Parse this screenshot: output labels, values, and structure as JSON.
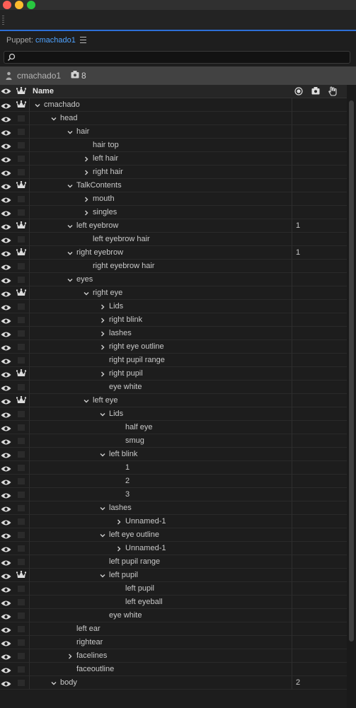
{
  "panel": {
    "title_prefix": "Puppet:",
    "title_puppet": "cmachado1"
  },
  "search": {
    "placeholder": "",
    "value": ""
  },
  "puppet_bar": {
    "name": "cmachado1",
    "count": "8"
  },
  "columns": {
    "name": "Name"
  },
  "rows": [
    {
      "label": "cmachado",
      "depth": 0,
      "expander": "open",
      "crown": true,
      "num": ""
    },
    {
      "label": "head",
      "depth": 1,
      "expander": "open",
      "crown": false,
      "num": ""
    },
    {
      "label": "hair",
      "depth": 2,
      "expander": "open",
      "crown": false,
      "num": ""
    },
    {
      "label": "hair top",
      "depth": 3,
      "expander": "none",
      "crown": false,
      "num": ""
    },
    {
      "label": "left hair",
      "depth": 3,
      "expander": "closed",
      "crown": false,
      "num": ""
    },
    {
      "label": "right hair",
      "depth": 3,
      "expander": "closed",
      "crown": false,
      "num": ""
    },
    {
      "label": "TalkContents",
      "depth": 2,
      "expander": "open",
      "crown": true,
      "num": ""
    },
    {
      "label": "mouth",
      "depth": 3,
      "expander": "closed",
      "crown": false,
      "num": ""
    },
    {
      "label": "singles",
      "depth": 3,
      "expander": "closed",
      "crown": false,
      "num": ""
    },
    {
      "label": "left eyebrow",
      "depth": 2,
      "expander": "open",
      "crown": true,
      "num": "1"
    },
    {
      "label": "left eyebrow hair",
      "depth": 3,
      "expander": "none",
      "crown": false,
      "num": ""
    },
    {
      "label": "right eyebrow",
      "depth": 2,
      "expander": "open",
      "crown": true,
      "num": "1"
    },
    {
      "label": "right eyebrow hair",
      "depth": 3,
      "expander": "none",
      "crown": false,
      "num": ""
    },
    {
      "label": "eyes",
      "depth": 2,
      "expander": "open",
      "crown": false,
      "num": ""
    },
    {
      "label": "right eye",
      "depth": 3,
      "expander": "open",
      "crown": true,
      "num": ""
    },
    {
      "label": "Lids",
      "depth": 4,
      "expander": "closed",
      "crown": false,
      "num": ""
    },
    {
      "label": "right blink",
      "depth": 4,
      "expander": "closed",
      "crown": false,
      "num": ""
    },
    {
      "label": "lashes",
      "depth": 4,
      "expander": "closed",
      "crown": false,
      "num": ""
    },
    {
      "label": "right eye outline",
      "depth": 4,
      "expander": "closed",
      "crown": false,
      "num": ""
    },
    {
      "label": "right pupil range",
      "depth": 4,
      "expander": "none",
      "crown": false,
      "num": ""
    },
    {
      "label": "right pupil",
      "depth": 4,
      "expander": "closed",
      "crown": true,
      "num": ""
    },
    {
      "label": "eye white",
      "depth": 4,
      "expander": "none",
      "crown": false,
      "num": ""
    },
    {
      "label": "left eye",
      "depth": 3,
      "expander": "open",
      "crown": true,
      "num": ""
    },
    {
      "label": "Lids",
      "depth": 4,
      "expander": "open",
      "crown": false,
      "num": ""
    },
    {
      "label": "half eye",
      "depth": 5,
      "expander": "none",
      "crown": false,
      "num": ""
    },
    {
      "label": "smug",
      "depth": 5,
      "expander": "none",
      "crown": false,
      "num": ""
    },
    {
      "label": "left blink",
      "depth": 4,
      "expander": "open",
      "crown": false,
      "num": ""
    },
    {
      "label": "1",
      "depth": 5,
      "expander": "none",
      "crown": false,
      "num": ""
    },
    {
      "label": "2",
      "depth": 5,
      "expander": "none",
      "crown": false,
      "num": ""
    },
    {
      "label": "3",
      "depth": 5,
      "expander": "none",
      "crown": false,
      "num": ""
    },
    {
      "label": "lashes",
      "depth": 4,
      "expander": "open",
      "crown": false,
      "num": ""
    },
    {
      "label": "Unnamed-1",
      "depth": 5,
      "expander": "closed",
      "crown": false,
      "num": ""
    },
    {
      "label": "left eye outline",
      "depth": 4,
      "expander": "open",
      "crown": false,
      "num": ""
    },
    {
      "label": "Unnamed-1",
      "depth": 5,
      "expander": "closed",
      "crown": false,
      "num": ""
    },
    {
      "label": "left pupil range",
      "depth": 4,
      "expander": "none",
      "crown": false,
      "num": ""
    },
    {
      "label": "left pupil",
      "depth": 4,
      "expander": "open",
      "crown": true,
      "num": ""
    },
    {
      "label": "left pupil",
      "depth": 5,
      "expander": "none",
      "crown": false,
      "num": ""
    },
    {
      "label": "left eyeball",
      "depth": 5,
      "expander": "none",
      "crown": false,
      "num": ""
    },
    {
      "label": "eye white",
      "depth": 4,
      "expander": "none",
      "crown": false,
      "num": ""
    },
    {
      "label": "left ear",
      "depth": 2,
      "expander": "none",
      "crown": false,
      "num": ""
    },
    {
      "label": "rightear",
      "depth": 2,
      "expander": "none",
      "crown": false,
      "num": ""
    },
    {
      "label": "facelines",
      "depth": 2,
      "expander": "closed",
      "crown": false,
      "num": ""
    },
    {
      "label": "faceoutline",
      "depth": 2,
      "expander": "none",
      "crown": false,
      "num": ""
    },
    {
      "label": "body",
      "depth": 1,
      "expander": "open",
      "crown": false,
      "num": "2"
    }
  ],
  "icons": {
    "visibility": "eye-icon",
    "independent": "crown-icon",
    "record": "record-icon",
    "tag": "tag-icon",
    "handle": "hand-icon"
  },
  "colors": {
    "accent": "#2d6fd6",
    "link": "#4fa3ff",
    "row_bg": "#1d1d1d",
    "puppet_bar_bg": "#424242"
  }
}
